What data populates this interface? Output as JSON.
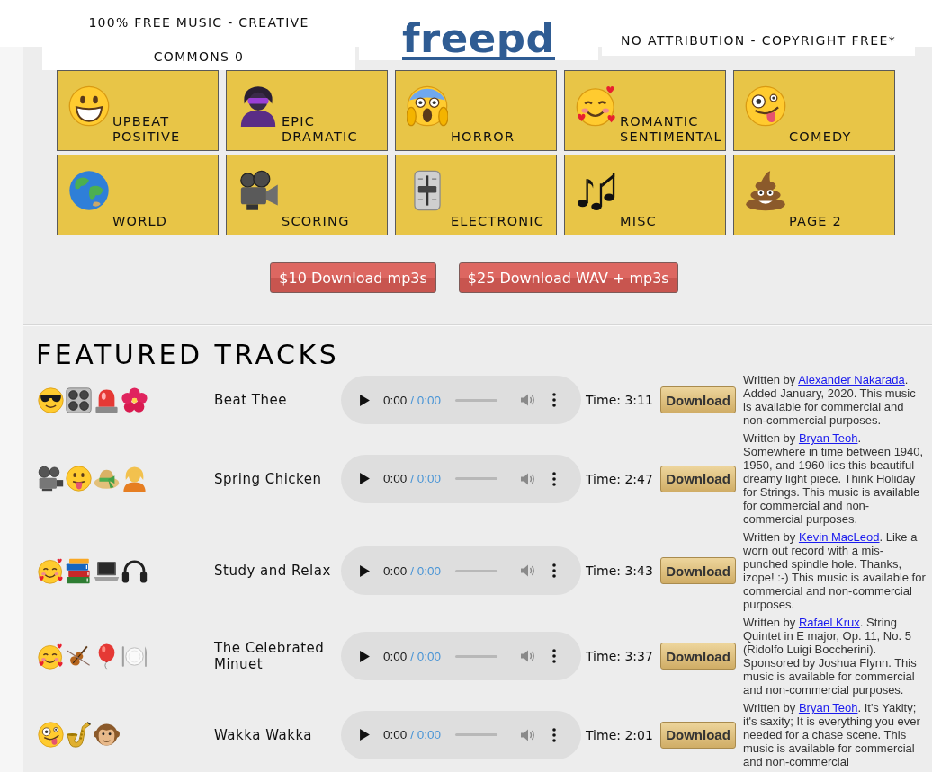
{
  "header": {
    "tagline_left": "100% FREE MUSIC - CREATIVE COMMONS 0",
    "logo": "freepd",
    "tagline_right": "NO ATTRIBUTION - COPYRIGHT FREE*"
  },
  "categories": [
    "UPBEAT POSITIVE",
    "EPIC DRAMATIC",
    "HORROR",
    "ROMANTIC SENTIMENTAL",
    "COMEDY",
    "WORLD",
    "SCORING",
    "ELECTRONIC",
    "MISC",
    "PAGE 2"
  ],
  "purchase_buttons": [
    "$10 Download mp3s",
    "$25 Download WAV + mp3s"
  ],
  "featured": {
    "title": "FEATURED TRACKS",
    "tracks": [
      {
        "title": "Beat Thee",
        "player": {
          "elapsed": "0:00",
          "duration": "/ 0:00"
        },
        "time": "Time: 3:11",
        "download_button": "Download",
        "description": {
          "before": "Written by",
          "author": "Alexander Nakarada",
          "after": ". Added January, 2020. This music is available for commercial and non-commercial purposes."
        }
      },
      {
        "title": "Spring Chicken",
        "player": {
          "elapsed": "0:00",
          "duration": "/ 0:00"
        },
        "time": "Time: 2:47",
        "download_button": "Download",
        "description": {
          "before": "Written by",
          "author": "Bryan Teoh",
          "after": ". Somewhere in time between 1940, 1950, and 1960 lies this beautiful dreamy light piece. Think Holiday for Strings. This music is available for commercial and non-commercial purposes."
        }
      },
      {
        "title": "Study and Relax",
        "player": {
          "elapsed": "0:00",
          "duration": "/ 0:00"
        },
        "time": "Time: 3:43",
        "download_button": "Download",
        "description": {
          "before": "Written by",
          "author": "Kevin MacLeod",
          "after": ". Like a worn out record with a mis-punched spindle hole. Thanks, izope! :-) This music is available for commercial and non-commercial purposes."
        }
      },
      {
        "title": "The Celebrated Minuet",
        "player": {
          "elapsed": "0:00",
          "duration": "/ 0:00"
        },
        "time": "Time: 3:37",
        "download_button": "Download",
        "description": {
          "before": "Written by",
          "author": "Rafael Krux",
          "after": ". String Quintet in E major, Op. 11, No. 5 (Ridolfo Luigi Boccherini). Sponsored by Joshua Flynn. This music is available for commercial and non-commercial purposes."
        }
      },
      {
        "title": "Wakka Wakka",
        "player": {
          "elapsed": "0:00",
          "duration": "/ 0:00"
        },
        "time": "Time: 2:01",
        "download_button": "Download",
        "description": {
          "before": "Written by",
          "author": "Bryan Teoh",
          "after": ". It's Yakity; it's saxity; It is everything you ever needed for a chase scene. This music is available for commercial and non-commercial"
        }
      }
    ]
  }
}
